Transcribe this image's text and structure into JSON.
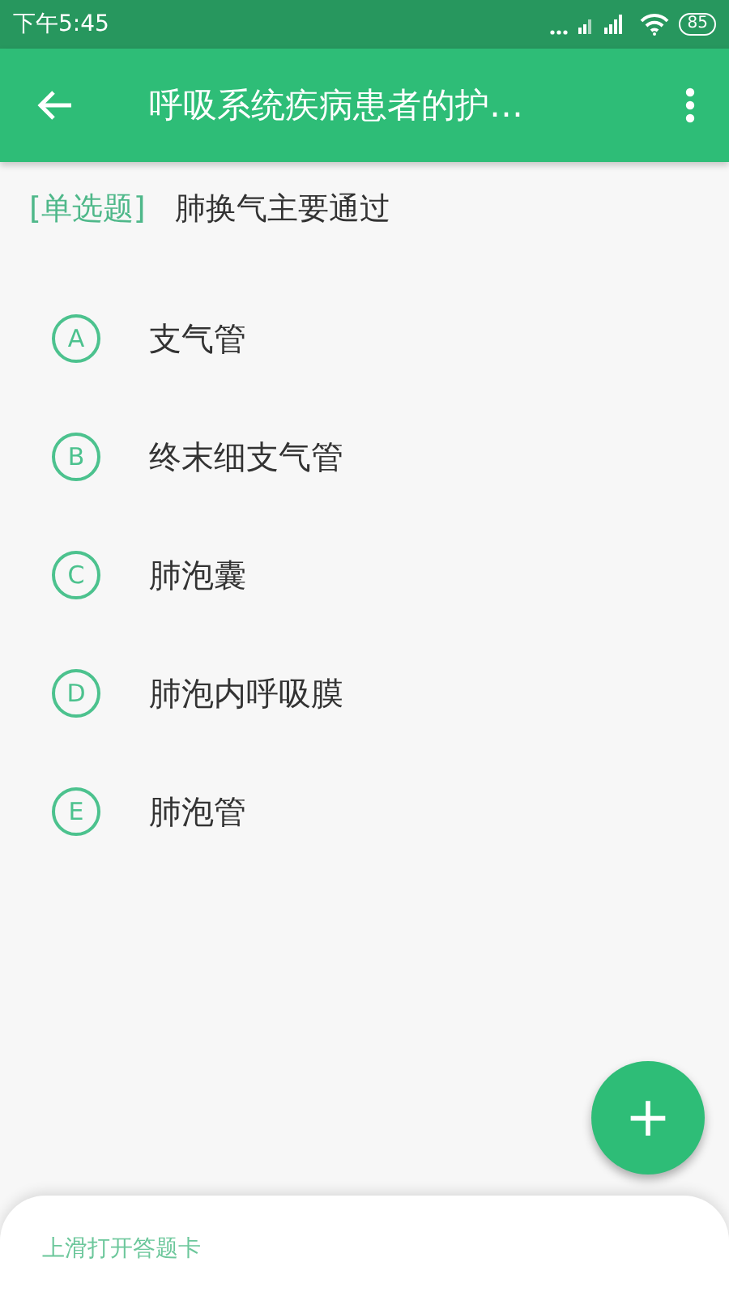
{
  "status_bar": {
    "time": "下午5:45",
    "battery": "85"
  },
  "app_bar": {
    "title": "呼吸系统疾病患者的护…"
  },
  "question": {
    "type_tag": "[单选题]",
    "text": "肺换气主要通过"
  },
  "options": [
    {
      "letter": "A",
      "text": "支气管",
      "selected": false
    },
    {
      "letter": "B",
      "text": "终末细支气管",
      "selected": false
    },
    {
      "letter": "C",
      "text": "肺泡囊",
      "selected": false
    },
    {
      "letter": "D",
      "text": "肺泡内呼吸膜",
      "selected": false
    },
    {
      "letter": "E",
      "text": "肺泡管",
      "selected": false
    }
  ],
  "fab": {
    "label": "+"
  },
  "bottom_sheet": {
    "hint": "上滑打开答题卡"
  }
}
